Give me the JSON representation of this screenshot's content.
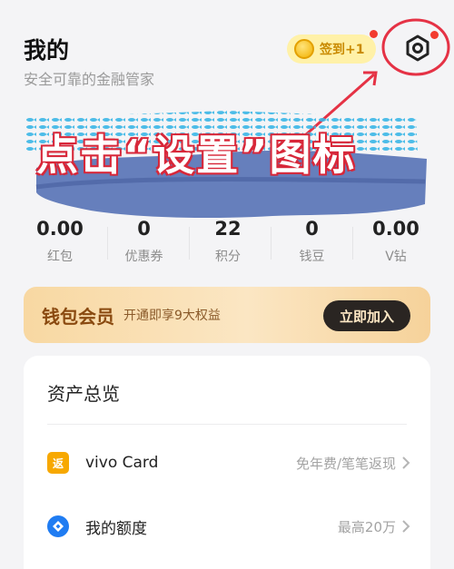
{
  "header": {
    "title": "我的",
    "subtitle": "安全可靠的金融管家",
    "checkin_label": "签到+1"
  },
  "annotation": {
    "text": "点击“设置”图标"
  },
  "stats": [
    {
      "value": "0.00",
      "label": "红包"
    },
    {
      "value": "0",
      "label": "优惠券"
    },
    {
      "value": "22",
      "label": "积分"
    },
    {
      "value": "0",
      "label": "钱豆"
    },
    {
      "value": "0.00",
      "label": "V钻"
    }
  ],
  "member": {
    "title": "钱包会员",
    "desc": "开通即享9大权益",
    "button": "立即加入"
  },
  "assets": {
    "title": "资产总览",
    "rows": [
      {
        "icon": "返",
        "label": "vivo Card",
        "note": "免年费/笔笔返现"
      },
      {
        "label": "我的额度",
        "note": "最高20万"
      }
    ]
  },
  "icons": {
    "settings": "settings-hex-icon",
    "coin": "coin-icon",
    "chevron": "chevron-right-icon"
  },
  "colors": {
    "accent_red": "#f23b2f",
    "annotation_red": "#d8283a",
    "card_orange": "#f7a800",
    "credit_blue": "#1f7cf2"
  }
}
